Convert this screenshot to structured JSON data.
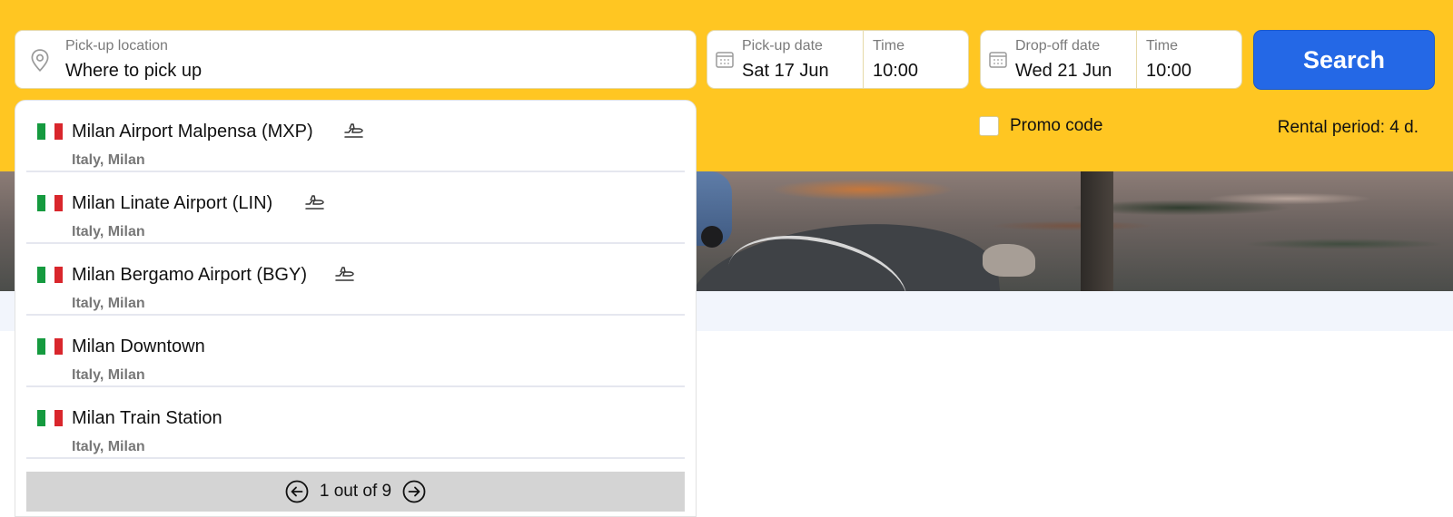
{
  "search_form": {
    "location": {
      "label": "Pick-up location",
      "placeholder": "Where to pick up"
    },
    "pickup": {
      "date_label": "Pick-up date",
      "date_value": "Sat 17 Jun",
      "time_label": "Time",
      "time_value": "10:00"
    },
    "dropoff": {
      "date_label": "Drop-off date",
      "date_value": "Wed 21 Jun",
      "time_label": "Time",
      "time_value": "10:00"
    },
    "search_label": "Search",
    "promo_label": "Promo code",
    "rental_period": "Rental period: 4 d."
  },
  "suggestions": [
    {
      "name": "Milan Airport Malpensa (MXP)",
      "sub": "Italy, Milan",
      "icon": "plane-icon"
    },
    {
      "name": "Milan Linate Airport (LIN)",
      "sub": "Italy, Milan",
      "icon": "plane-icon"
    },
    {
      "name": "Milan Bergamo Airport (BGY)",
      "sub": "Italy, Milan",
      "icon": "plane-icon"
    },
    {
      "name": "Milan Downtown",
      "sub": "Italy, Milan",
      "icon": ""
    },
    {
      "name": "Milan Train Station",
      "sub": "Italy, Milan",
      "icon": ""
    }
  ],
  "pager": {
    "text": "1 out of 9"
  },
  "colors": {
    "header_bg": "#ffc622",
    "search_button": "#2468e6",
    "flag_green": "#159a3f",
    "flag_white": "#ffffff",
    "flag_red": "#d9262c"
  }
}
